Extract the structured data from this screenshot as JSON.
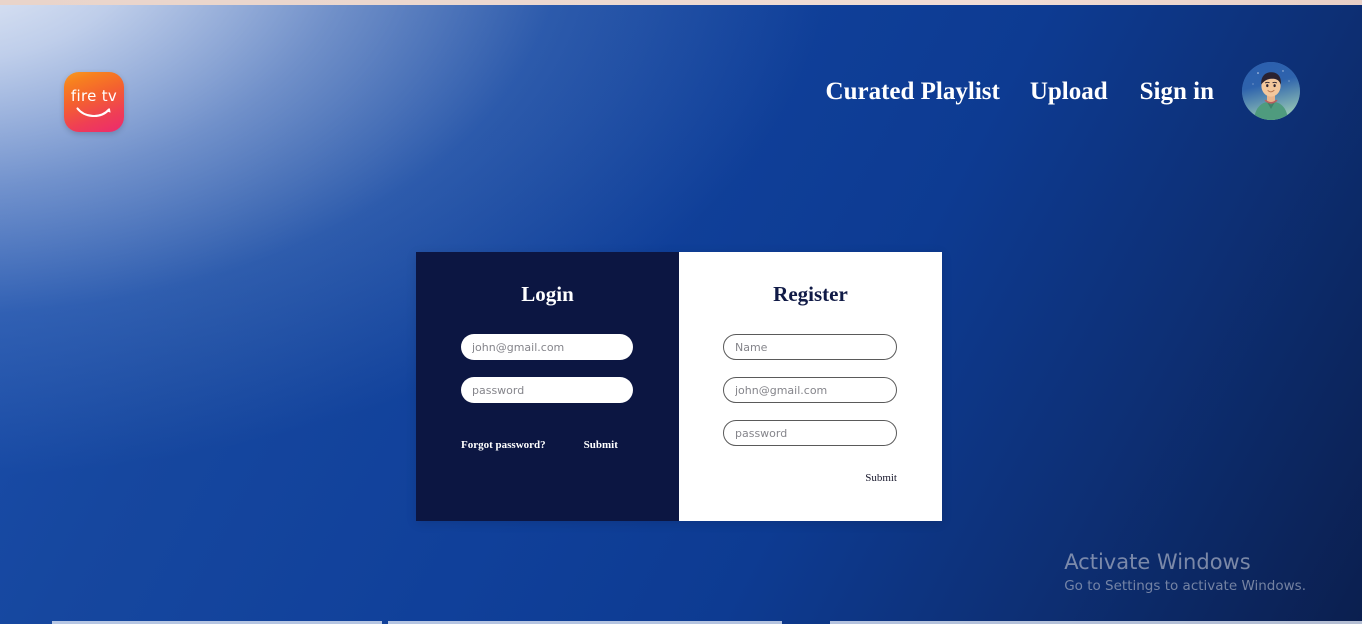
{
  "page": {
    "background_top_left": "#e8eefa",
    "background_mid": "#2f62bd",
    "background_bottom_right": "#0b1f4f",
    "top_strip_color": "#ecd8cf"
  },
  "header": {
    "logo": {
      "name": "fire-tv-logo",
      "wordmark": "fire tv",
      "gradient_start": "#f79a22",
      "gradient_end": "#ec2a6e"
    },
    "nav_links": [
      {
        "label": "Curated Playlist",
        "name": "nav-curated-playlist"
      },
      {
        "label": "Upload",
        "name": "nav-upload"
      },
      {
        "label": "Sign in",
        "name": "nav-sign-in"
      }
    ],
    "avatar": {
      "name": "user-avatar",
      "alt": "user profile picture"
    }
  },
  "auth": {
    "login": {
      "title": "Login",
      "panel_color": "#0c1642",
      "fields": [
        {
          "name": "login-email-input",
          "placeholder": "john@gmail.com",
          "value": "",
          "type": "email"
        },
        {
          "name": "login-password-input",
          "placeholder": "password",
          "value": "",
          "type": "password"
        }
      ],
      "forgot_label": "Forgot password?",
      "submit_label": "Submit"
    },
    "register": {
      "title": "Register",
      "panel_color": "#ffffff",
      "fields": [
        {
          "name": "register-name-input",
          "placeholder": "Name",
          "value": "",
          "type": "text"
        },
        {
          "name": "register-email-input",
          "placeholder": "john@gmail.com",
          "value": "",
          "type": "email"
        },
        {
          "name": "register-password-input",
          "placeholder": "password",
          "value": "",
          "type": "password"
        }
      ],
      "submit_label": "Submit"
    }
  },
  "watermark": {
    "title": "Activate Windows",
    "subtitle": "Go to Settings to activate Windows."
  }
}
